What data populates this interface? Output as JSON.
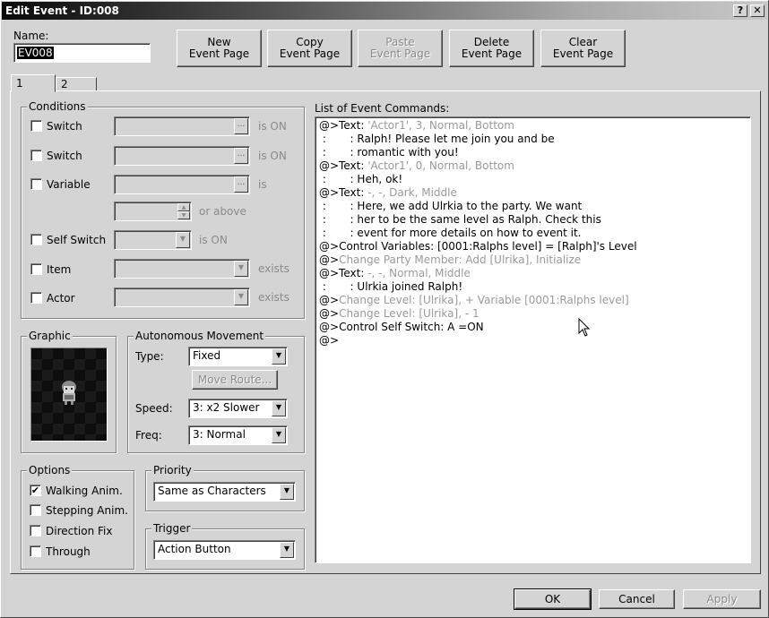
{
  "window": {
    "title": "Edit Event - ID:008",
    "help_label": "?",
    "close_label": "✕"
  },
  "name": {
    "label": "Name:",
    "value": "EV008"
  },
  "toolbar": {
    "new_page": "New\nEvent Page",
    "copy_page": "Copy\nEvent Page",
    "paste_page": "Paste\nEvent Page",
    "delete_page": "Delete\nEvent Page",
    "clear_page": "Clear\nEvent Page"
  },
  "tabs": [
    {
      "label": "1",
      "active": true
    },
    {
      "label": "2",
      "active": false
    }
  ],
  "conditions": {
    "title": "Conditions",
    "switch1": {
      "label": "Switch",
      "checked": false,
      "suffix": "is ON",
      "button": "..."
    },
    "switch2": {
      "label": "Switch",
      "checked": false,
      "suffix": "is ON",
      "button": "..."
    },
    "variable": {
      "label": "Variable",
      "checked": false,
      "suffix": "is",
      "button": "...",
      "or_above": "or above"
    },
    "self_switch": {
      "label": "Self Switch",
      "checked": false,
      "suffix": "is ON"
    },
    "item": {
      "label": "Item",
      "checked": false,
      "suffix": "exists"
    },
    "actor": {
      "label": "Actor",
      "checked": false,
      "suffix": "exists"
    }
  },
  "graphic": {
    "title": "Graphic",
    "sprite": "character-sprite"
  },
  "movement": {
    "title": "Autonomous Movement",
    "type_label": "Type:",
    "type_value": "Fixed",
    "move_route": "Move Route...",
    "speed_label": "Speed:",
    "speed_value": "3: x2 Slower",
    "freq_label": "Freq:",
    "freq_value": "3: Normal"
  },
  "options": {
    "title": "Options",
    "walking": {
      "label": "Walking Anim.",
      "checked": true,
      "mark": "✔"
    },
    "stepping": {
      "label": "Stepping Anim.",
      "checked": false
    },
    "direction_fix": {
      "label": "Direction Fix",
      "checked": false
    },
    "through": {
      "label": "Through",
      "checked": false
    }
  },
  "priority": {
    "title": "Priority",
    "value": "Same as Characters"
  },
  "trigger": {
    "title": "Trigger",
    "value": "Action Button"
  },
  "commands": {
    "title": "List of Event Commands:",
    "lines": [
      {
        "prefix": "@>Text: ",
        "text": "'Actor1', 3, Normal, Bottom",
        "dim": true
      },
      {
        "prefix": " :       : ",
        "text": "Ralph! Please let me join you and be",
        "dim": false
      },
      {
        "prefix": " :       : ",
        "text": "romantic with you!",
        "dim": false
      },
      {
        "prefix": "@>Text: ",
        "text": "'Actor1', 0, Normal, Bottom",
        "dim": true
      },
      {
        "prefix": " :       : ",
        "text": "Heh, ok!",
        "dim": false
      },
      {
        "prefix": "@>Text: ",
        "text": "-, -, Dark, Middle",
        "dim": true
      },
      {
        "prefix": " :       : ",
        "text": "Here, we add Ulrkia to the party. We want",
        "dim": false
      },
      {
        "prefix": " :       : ",
        "text": "her to be the same level as Ralph. Check this",
        "dim": false
      },
      {
        "prefix": " :       : ",
        "text": "event for more details on how to event it.",
        "dim": false
      },
      {
        "prefix": "@>",
        "text": "Control Variables: [0001:Ralphs level] = [Ralph]'s Level",
        "dim": false
      },
      {
        "prefix": "@>",
        "text": "Change Party Member: Add [Ulrika], Initialize",
        "dim": true
      },
      {
        "prefix": "@>Text: ",
        "text": "-, -, Normal, Middle",
        "dim": true
      },
      {
        "prefix": " :       : ",
        "text": "Ulrkia joined Ralph!",
        "dim": false
      },
      {
        "prefix": "@>",
        "text": "Change Level: [Ulrika], + Variable [0001:Ralphs level]",
        "dim": true
      },
      {
        "prefix": "@>",
        "text": "Change Level: [Ulrika], - 1",
        "dim": true
      },
      {
        "prefix": "@>",
        "text": "Control Self Switch: A =ON",
        "dim": false
      },
      {
        "prefix": "@>",
        "text": "",
        "dim": false
      }
    ]
  },
  "footer": {
    "ok": "OK",
    "cancel": "Cancel",
    "apply": "Apply"
  }
}
